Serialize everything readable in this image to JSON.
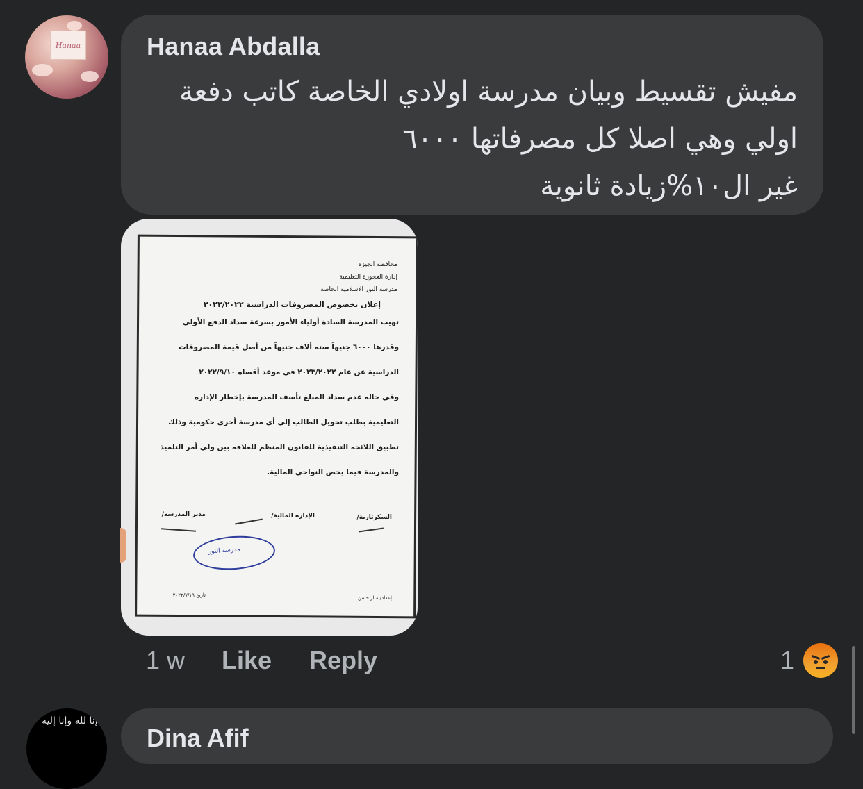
{
  "comment": {
    "author": "Hanaa Abdalla",
    "avatar_label": "Hanaa",
    "text_lines": [
      "مفيش تقسيط وبيان مدرسة اولادي الخاصة كاتب دفعة",
      "اولي وهي اصلا كل مصرفاتها ٦٠٠٠",
      "غير ال١٠%زيادة ثانوية"
    ],
    "time": "1 w",
    "like_label": "Like",
    "reply_label": "Reply",
    "reaction_count": "1",
    "reaction_icon": "angry-reaction-icon"
  },
  "document": {
    "header_lines": [
      "محافظة الجيزة",
      "إدارة العجوزة التعليمية",
      "مدرسة النور الاسلامية الخاصة"
    ],
    "title": "إعلان بخصوص المصروفات الدراسية ٢٠٢٣/٢٠٢٢",
    "body_lines": [
      "تهيب المدرسة السادة أولياء الأمور بسرعة سداد الدفع الأولي",
      "وقدرها ٦٠٠٠ جنيهاً سته ألاف جنيهاً من أصل قيمة المصروفات",
      "الدراسية عن عام ٢٠٢٣/٢٠٢٢ في موعد أقصاه ٢٠٢٢/٩/١٠",
      "وفي حاله عدم سداد المبلغ تأسف المدرسة بإخطار الإداره",
      "التعليمية بطلب تحويل الطالب إلي أي مدرسة أخري حكومية وذلك",
      "تطبيق اللائحه التنفيذية للقانون المنظم للعلاقه بين ولي أمر التلميذ",
      "والمدرسة فيما يخص النواحي المالية."
    ],
    "sig_secretary": "السكرتارية/",
    "sig_finance": "الإداره المالية/",
    "sig_director": "مدير المدرسه/",
    "stamp_text": "مدرسة النور",
    "footer_prepared": "إعداد/ منار حسن",
    "footer_date": "تاريخ ٢٠٢٢/٧/١٩"
  },
  "next_comment": {
    "author": "Dina Afif",
    "avatar_text": "إنا لله وإنا إليه"
  }
}
